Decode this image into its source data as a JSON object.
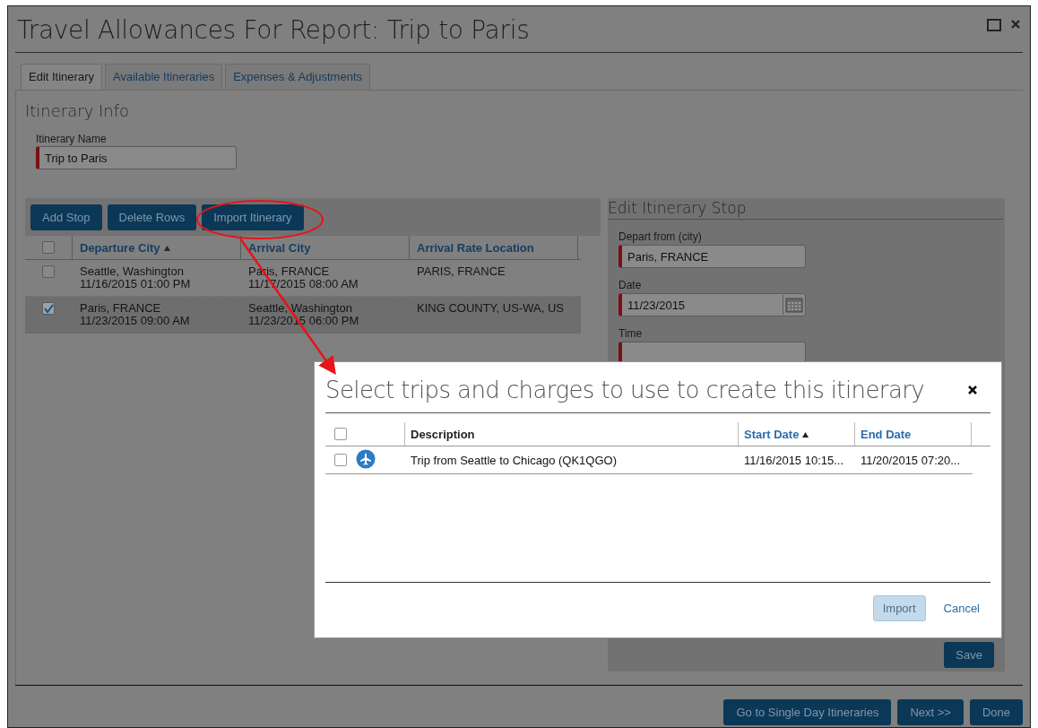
{
  "window": {
    "title": "Travel Allowances For Report: Trip to Paris"
  },
  "tabs": [
    {
      "label": "Edit Itinerary",
      "selected": true
    },
    {
      "label": "Available Itineraries",
      "selected": false
    },
    {
      "label": "Expenses & Adjustments",
      "selected": false
    }
  ],
  "itinerary_info": {
    "heading": "Itinerary Info",
    "name_label": "Itinerary Name",
    "name_value": "Trip to Paris"
  },
  "toolbar": [
    "Add Stop",
    "Delete Rows",
    "Import Itinerary"
  ],
  "stops_table": {
    "all_checked": false,
    "columns": [
      {
        "label": "Departure City",
        "sorted": true
      },
      {
        "label": "Arrival City",
        "sorted": false
      },
      {
        "label": "Arrival Rate Location",
        "sorted": false
      }
    ],
    "rows": [
      {
        "checked": false,
        "departure_city": "Seattle, Washington",
        "departure_time": "11/16/2015 01:00 PM",
        "arrival_city": "Paris, FRANCE",
        "arrival_time": "11/17/2015 08:00 AM",
        "rate_location": "PARIS, FRANCE"
      },
      {
        "checked": true,
        "departure_city": "Paris, FRANCE",
        "departure_time": "11/23/2015 09:00 AM",
        "arrival_city": "Seattle, Washington",
        "arrival_time": "11/23/2015 06:00 PM",
        "rate_location": "KING COUNTY, US-WA, US"
      }
    ]
  },
  "edit_stop": {
    "heading": "Edit Itinerary Stop",
    "fields": [
      {
        "kind": "text",
        "label": "Depart from (city)",
        "value": "Paris, FRANCE"
      },
      {
        "kind": "date",
        "label": "Date",
        "value": "11/23/2015"
      },
      {
        "kind": "text",
        "label": "Time"
      }
    ],
    "save": "Save"
  },
  "dialog": {
    "title": "Select trips and charges to use to create this itinerary",
    "all_checked": false,
    "columns": [
      {
        "label": "Description",
        "sorted": false,
        "link": false
      },
      {
        "label": "Start Date",
        "sorted": true,
        "link": true
      },
      {
        "label": "End Date",
        "sorted": false,
        "link": true
      }
    ],
    "rows": [
      {
        "checked": false,
        "kind": "air",
        "description": "Trip from Seattle to Chicago (QK1QGO)",
        "start": "11/16/2015 10:15...",
        "end": "11/20/2015 07:20..."
      }
    ],
    "import": {
      "label": "Import",
      "disabled": true
    },
    "cancel": "Cancel"
  },
  "footer": [
    "Go to Single Day Itineraries",
    "Next >>",
    "Done"
  ]
}
